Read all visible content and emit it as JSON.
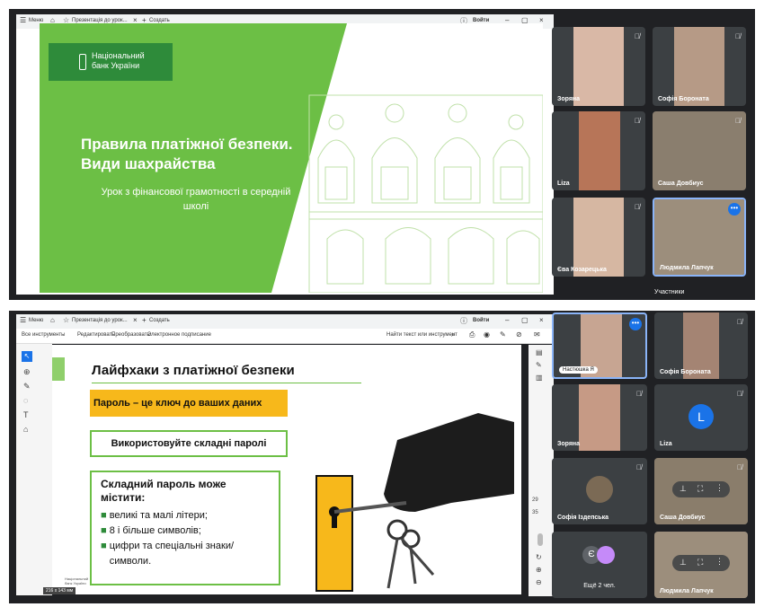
{
  "top": {
    "toolbar": {
      "menu": "Меню",
      "tab": "Презентація до урок...",
      "new": "Создать",
      "login": "Войти"
    },
    "slide": {
      "bank_name_line1": "Національний",
      "bank_name_line2": "банк України",
      "title_line1": "Правила платіжної безпеки.",
      "title_line2": "Види шахрайства",
      "subtitle_line1": "Урок з фінансової грамотності в середній",
      "subtitle_line2": "школі"
    },
    "participants": [
      "Зоряна",
      "Софія Бороната",
      "Liza",
      "Саша Довбиус",
      "Єва Козарецька",
      "Людмила Лапчук"
    ],
    "participants_label": "Участники"
  },
  "bottom": {
    "toolbar": {
      "menu": "Меню",
      "tab": "Презентація до урок...",
      "new": "Создать",
      "login": "Войти"
    },
    "pdf_toolbar": {
      "all_tools": "Все инструменты",
      "edit": "Редактировать",
      "convert": "Преобразовать",
      "esign": "Электронное подписание",
      "search": "Найти текст или инструмент"
    },
    "slide": {
      "title": "Лайфхаки з платіжної безпеки",
      "highlight": "Пароль – це ключ до ваших даних",
      "box1": "Використовуйте складні паролі",
      "box2_title_line1": "Складний пароль може",
      "box2_title_line2": "містити:",
      "items": [
        "великі та малі літери;",
        "8 і більше символів;",
        "цифри та спеціальні знаки/символи."
      ],
      "footer_logo_line1": "Національний",
      "footer_logo_line2": "банк України"
    },
    "page_size": "216 x 143 мм",
    "page_numbers": [
      "29",
      "35"
    ],
    "participants": [
      "Настюшка Я",
      "Софія Бороната",
      "Зоряна",
      "Liza",
      "Софія Іздепська",
      "Саша Довбиус",
      "Ещё 2 чел.",
      "Людмила Лапчук"
    ],
    "avatar_letter": "L",
    "avatar_letter_small": "Є",
    "colors": {
      "green": "#6cbf45",
      "dark_green": "#2e8b3a",
      "yellow": "#f7b81b",
      "meet_bg": "#202124",
      "tile_bg": "#3c4043",
      "accent_blue": "#1a73e8"
    }
  }
}
